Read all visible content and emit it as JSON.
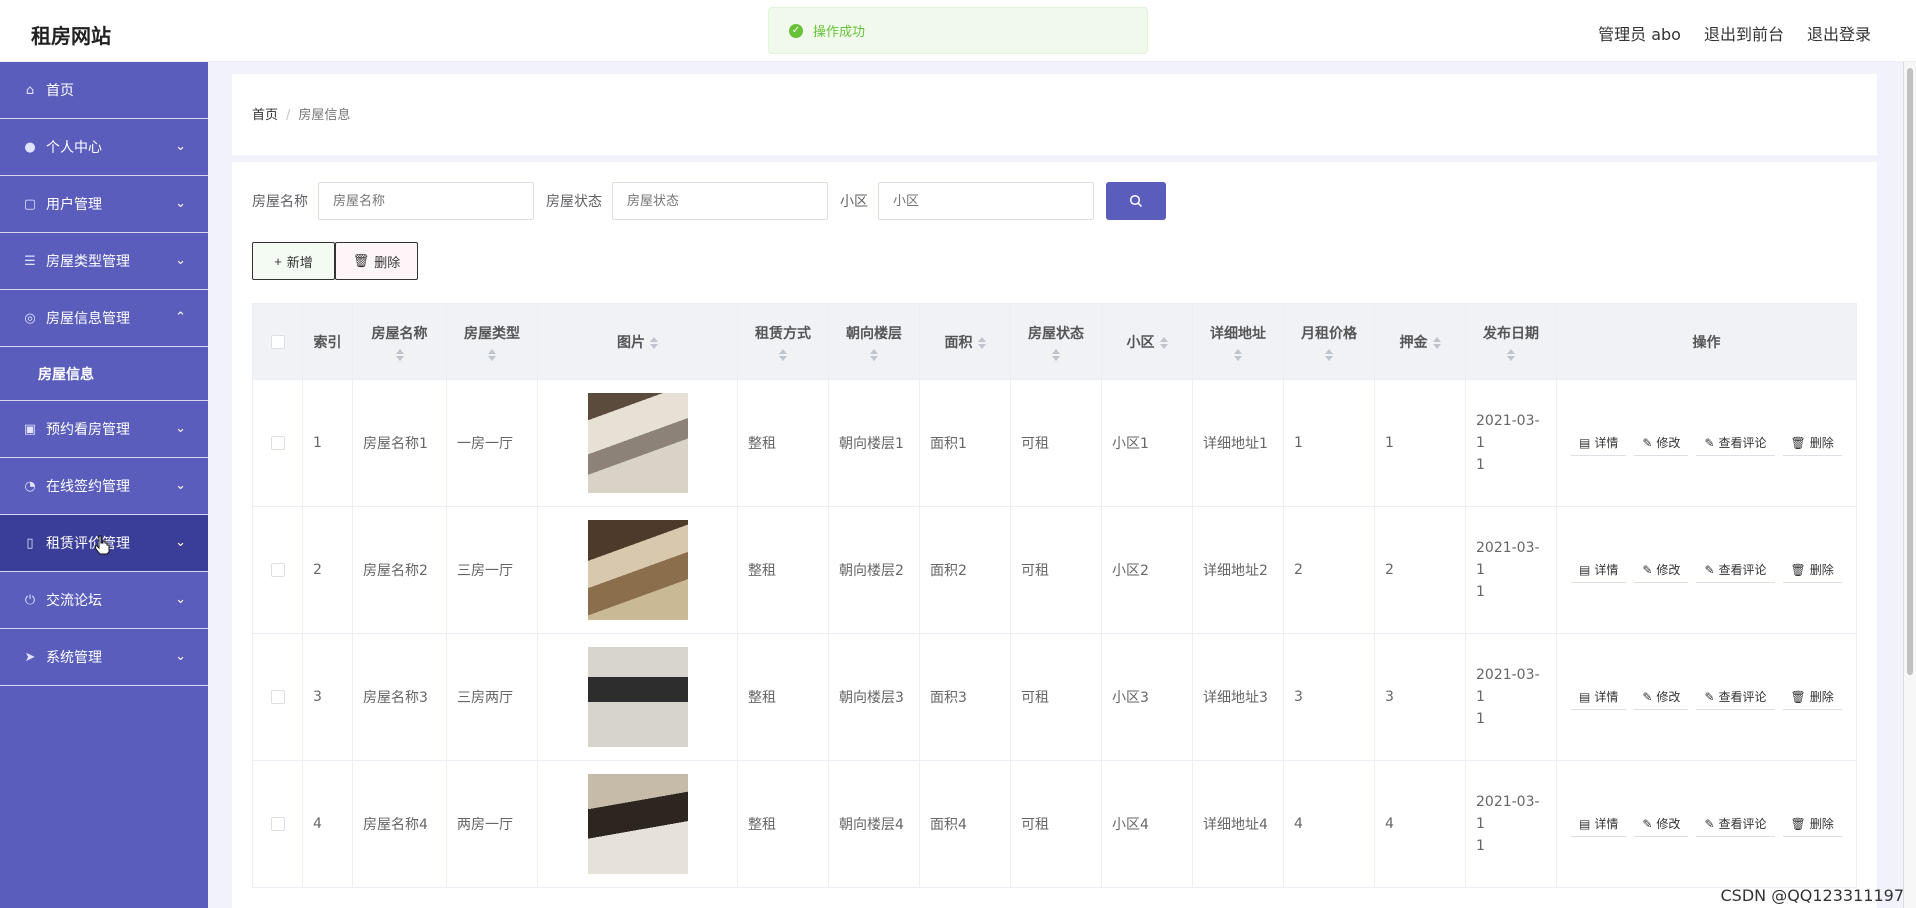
{
  "app": {
    "title": "租房网站"
  },
  "toast": {
    "message": "操作成功"
  },
  "top_links": [
    {
      "label": "管理员 abo"
    },
    {
      "label": "退出到前台"
    },
    {
      "label": "退出登录"
    }
  ],
  "sidebar": {
    "items": [
      {
        "label": "首页",
        "icon": "home-icon"
      },
      {
        "label": "个人中心",
        "icon": "user-icon"
      },
      {
        "label": "用户管理",
        "icon": "copy-icon"
      },
      {
        "label": "房屋类型管理",
        "icon": "sliders-icon"
      },
      {
        "label": "房屋信息管理",
        "icon": "compass-icon"
      },
      {
        "label": "房屋信息",
        "icon": ""
      },
      {
        "label": "预约看房管理",
        "icon": "suitcase-icon"
      },
      {
        "label": "在线签约管理",
        "icon": "gauge-icon"
      },
      {
        "label": "租赁评价管理",
        "icon": "mobile-icon"
      },
      {
        "label": "交流论坛",
        "icon": "power-icon"
      },
      {
        "label": "系统管理",
        "icon": "send-icon"
      }
    ]
  },
  "breadcrumb": {
    "home": "首页",
    "current": "房屋信息"
  },
  "filters": {
    "name_label": "房屋名称",
    "name_placeholder": "房屋名称",
    "status_label": "房屋状态",
    "status_placeholder": "房屋状态",
    "community_label": "小区",
    "community_placeholder": "小区"
  },
  "actions": {
    "add": "新增",
    "delete": "删除"
  },
  "table": {
    "headers": [
      "索引",
      "房屋名称",
      "房屋类型",
      "图片",
      "租赁方式",
      "朝向楼层",
      "面积",
      "房屋状态",
      "小区",
      "详细地址",
      "月租价格",
      "押金",
      "发布日期",
      "操作"
    ],
    "rows": [
      {
        "index": "1",
        "name": "房屋名称1",
        "type": "一房一厅",
        "lease": "整租",
        "orientation": "朝向楼层1",
        "area": "面积1",
        "status": "可租",
        "community": "小区1",
        "address": "详细地址1",
        "rent": "1",
        "deposit": "1",
        "date_a": "2021-03-1",
        "date_b": "1"
      },
      {
        "index": "2",
        "name": "房屋名称2",
        "type": "三房一厅",
        "lease": "整租",
        "orientation": "朝向楼层2",
        "area": "面积2",
        "status": "可租",
        "community": "小区2",
        "address": "详细地址2",
        "rent": "2",
        "deposit": "2",
        "date_a": "2021-03-1",
        "date_b": "1"
      },
      {
        "index": "3",
        "name": "房屋名称3",
        "type": "三房两厅",
        "lease": "整租",
        "orientation": "朝向楼层3",
        "area": "面积3",
        "status": "可租",
        "community": "小区3",
        "address": "详细地址3",
        "rent": "3",
        "deposit": "3",
        "date_a": "2021-03-1",
        "date_b": "1"
      },
      {
        "index": "4",
        "name": "房屋名称4",
        "type": "两房一厅",
        "lease": "整租",
        "orientation": "朝向楼层4",
        "area": "面积4",
        "status": "可租",
        "community": "小区4",
        "address": "详细地址4",
        "rent": "4",
        "deposit": "4",
        "date_a": "2021-03-1",
        "date_b": "1"
      }
    ],
    "row_actions": {
      "detail": "详情",
      "edit": "修改",
      "comments": "查看评论",
      "delete": "删除"
    }
  },
  "watermark": "CSDN @QQ123311197",
  "colors": {
    "sidebar": "#5a5dbc",
    "sidebar_active": "#3b3e98",
    "toast": "#67c23a"
  }
}
